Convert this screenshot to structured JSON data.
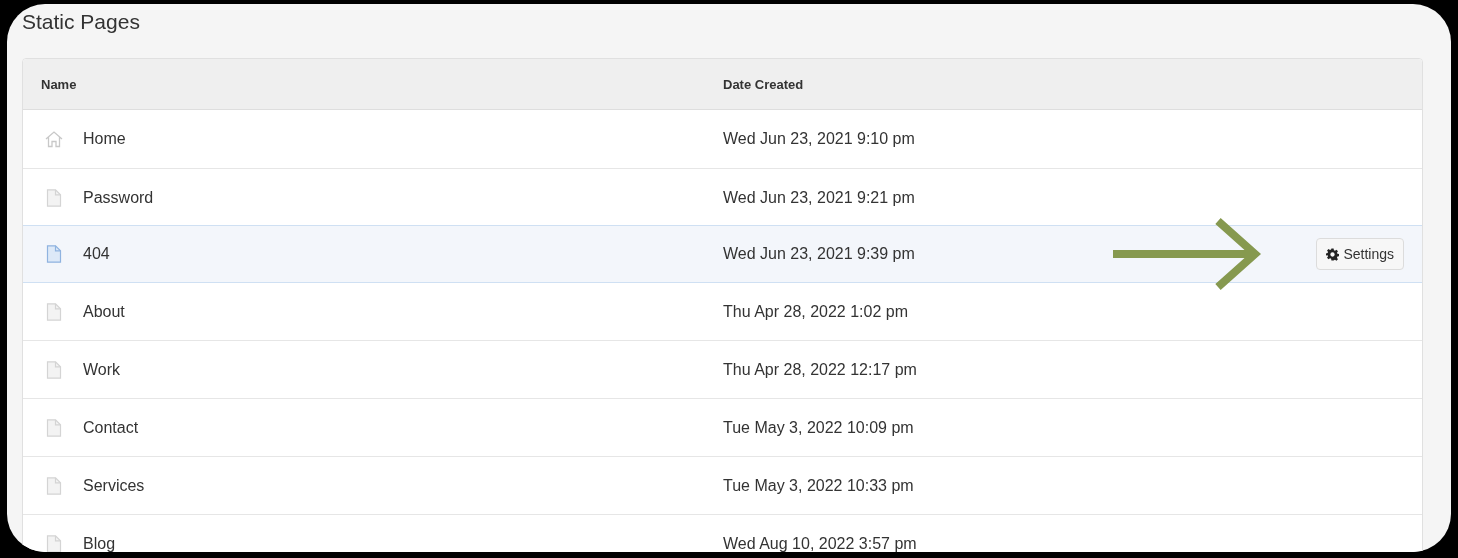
{
  "title": "Static Pages",
  "table": {
    "columns": [
      "Name",
      "Date Created"
    ],
    "rows": [
      {
        "kind": "home",
        "name": "Home",
        "date": "Wed Jun 23, 2021 9:10 pm",
        "selected": false
      },
      {
        "kind": "page",
        "name": "Password",
        "date": "Wed Jun 23, 2021 9:21 pm",
        "selected": false
      },
      {
        "kind": "page",
        "name": "404",
        "date": "Wed Jun 23, 2021 9:39 pm",
        "selected": true,
        "action": "Settings"
      },
      {
        "kind": "page",
        "name": "About",
        "date": "Thu Apr 28, 2022 1:02 pm",
        "selected": false
      },
      {
        "kind": "page",
        "name": "Work",
        "date": "Thu Apr 28, 2022 12:17 pm",
        "selected": false
      },
      {
        "kind": "page",
        "name": "Contact",
        "date": "Tue May 3, 2022 10:09 pm",
        "selected": false
      },
      {
        "kind": "page",
        "name": "Services",
        "date": "Tue May 3, 2022 10:33 pm",
        "selected": false
      },
      {
        "kind": "page",
        "name": "Blog",
        "date": "Wed Aug 10, 2022 3:57 pm",
        "selected": false
      }
    ]
  },
  "arrow_annotation": true
}
